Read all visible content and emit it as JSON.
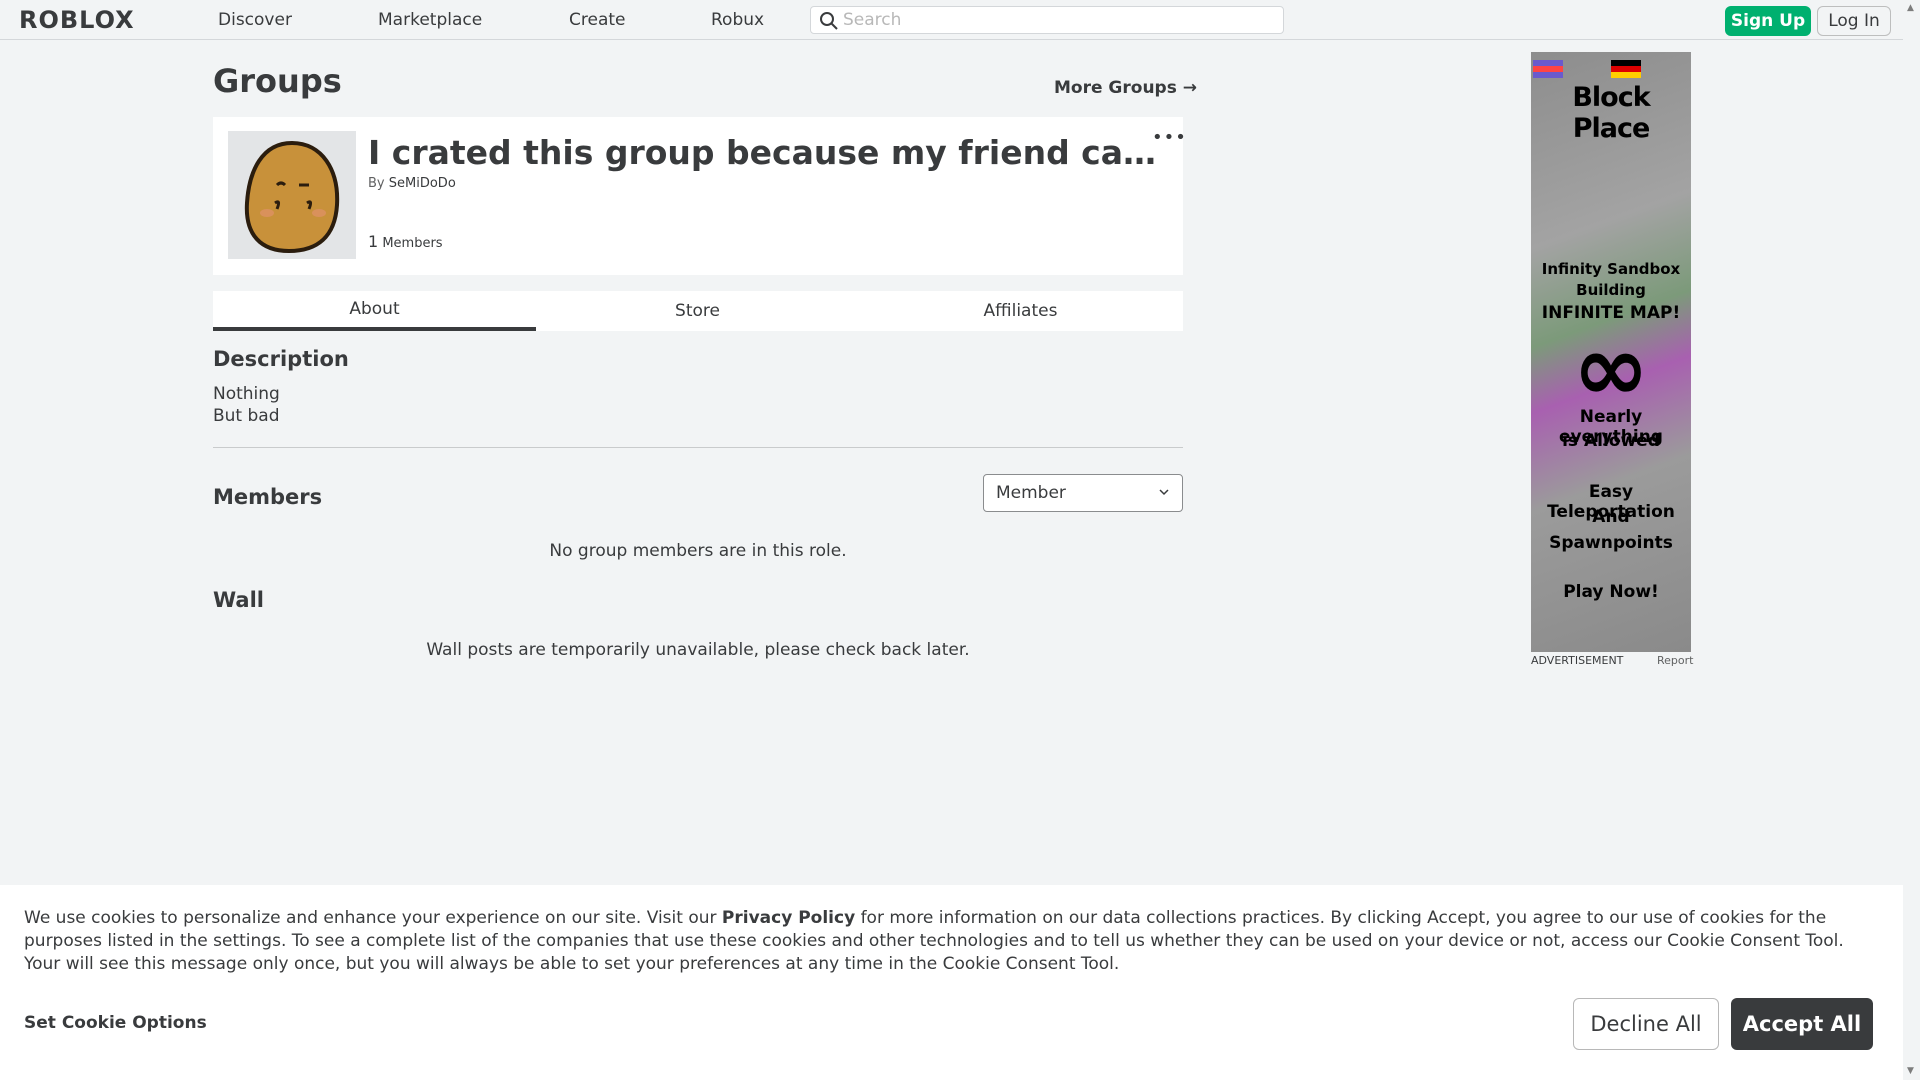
{
  "nav": {
    "logo": "ROBLOX",
    "items": [
      "Discover",
      "Marketplace",
      "Create",
      "Robux"
    ],
    "search_placeholder": "Search",
    "signup_label": "Sign Up",
    "login_label": "Log In"
  },
  "page": {
    "title": "Groups",
    "more_groups": "More Groups →"
  },
  "group": {
    "name": "I crated this group because my friend caug...",
    "owner_prefix": "By",
    "owner": "SeMiDoDo",
    "member_count": "1",
    "member_label": "Members",
    "more_dots": "•••"
  },
  "tabs": [
    "About",
    "Store",
    "Affiliates"
  ],
  "about": {
    "description_title": "Description",
    "description_lines": [
      "Nothing",
      "But bad"
    ],
    "members_title": "Members",
    "role_selected": "Member",
    "no_members_msg": "No group members are in this role.",
    "wall_title": "Wall",
    "wall_msg": "Wall posts are temporarily unavailable, please check back later."
  },
  "ad": {
    "title": "Block Place",
    "lines": [
      "Infinity Sandbox",
      "Building",
      "INFINITE MAP!",
      "∞",
      "Nearly everything",
      "is Allowed",
      "Easy Teleportation",
      "And",
      "Spawnpoints",
      "Play Now!"
    ],
    "caption": "ADVERTISEMENT",
    "report": "Report"
  },
  "cookie": {
    "text_1": "We use cookies to personalize and enhance your experience on our site. Visit our ",
    "privacy_link": "Privacy Policy",
    "text_2": " for more information on our data collections practices. By clicking Accept, you agree to our use of cookies for the purposes listed in the settings. To see a complete list of the companies that use these cookies and other technologies and to tell us whether they can be used on your device or not, access our Cookie Consent Tool. Your will see this message only once, but you will always be able to set your preferences at any time in the Cookie Consent Tool.",
    "options_label": "Set Cookie Options",
    "decline_label": "Decline All",
    "accept_label": "Accept All"
  },
  "colors": {
    "signup_green": "#00b06f",
    "accept_dark": "#393b3d",
    "background": "#f2f4f5"
  }
}
